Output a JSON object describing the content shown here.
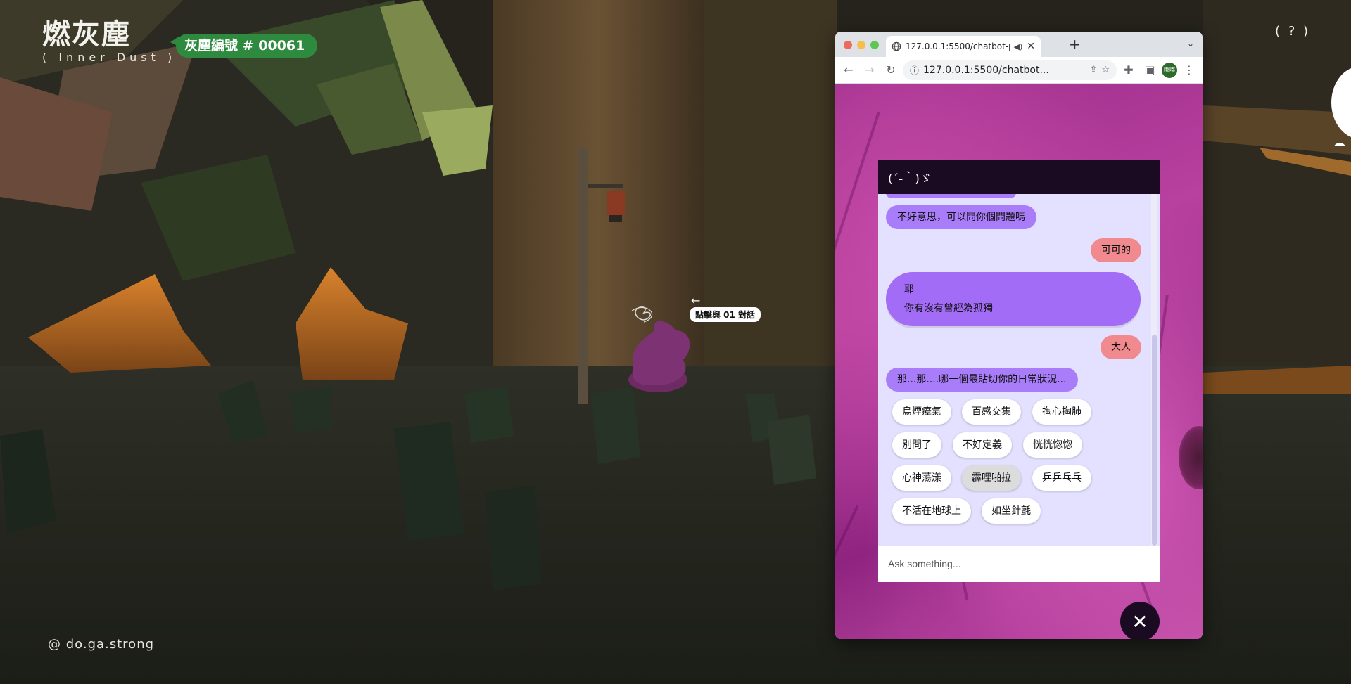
{
  "game": {
    "logo_title": "燃灰塵",
    "logo_subtitle": "( Inner Dust )",
    "dust_badge": "灰塵編號 # 00061",
    "help_label": "( ? )",
    "credit": "@ do.ga.strong",
    "npc_arrow": "←",
    "npc_prompt": "點擊與 01 對話"
  },
  "browser": {
    "tab_title": "127.0.0.1:5500/chatbot-po",
    "url": "127.0.0.1:5500/chatbot...",
    "profile_label": "嘟嘟",
    "new_tab_label": "+",
    "tab_close_label": "✕",
    "tab_menu_label": "⌄"
  },
  "chat": {
    "header_title": "(´-｀)ゞ",
    "messages": [
      {
        "role": "bot",
        "text": "不好意思，可以問你個問題嗎"
      },
      {
        "role": "user",
        "text": "可可的"
      },
      {
        "role": "bot",
        "line1": "耶",
        "line2": "你有沒有曾經為孤獨"
      },
      {
        "role": "user",
        "text": "大人"
      },
      {
        "role": "bot",
        "text": "那...那....哪一個最貼切你的日常狀況..."
      }
    ],
    "options": [
      "烏煙瘴氣",
      "百感交集",
      "掏心掏肺",
      "別問了",
      "不好定義",
      "恍恍惚惚",
      "心神蕩漾",
      "霹哩啪拉",
      "乒乒乓乓",
      "不活在地球上",
      "如坐針氈"
    ],
    "input_placeholder": "Ask something...",
    "close_label": "✕"
  },
  "colors": {
    "bot_bubble": "#a97dfa",
    "user_bubble": "#f08a8e",
    "chat_bg": "#e3e1ff",
    "chat_header": "#1b0b22",
    "badge_green": "#2e8a3e"
  }
}
